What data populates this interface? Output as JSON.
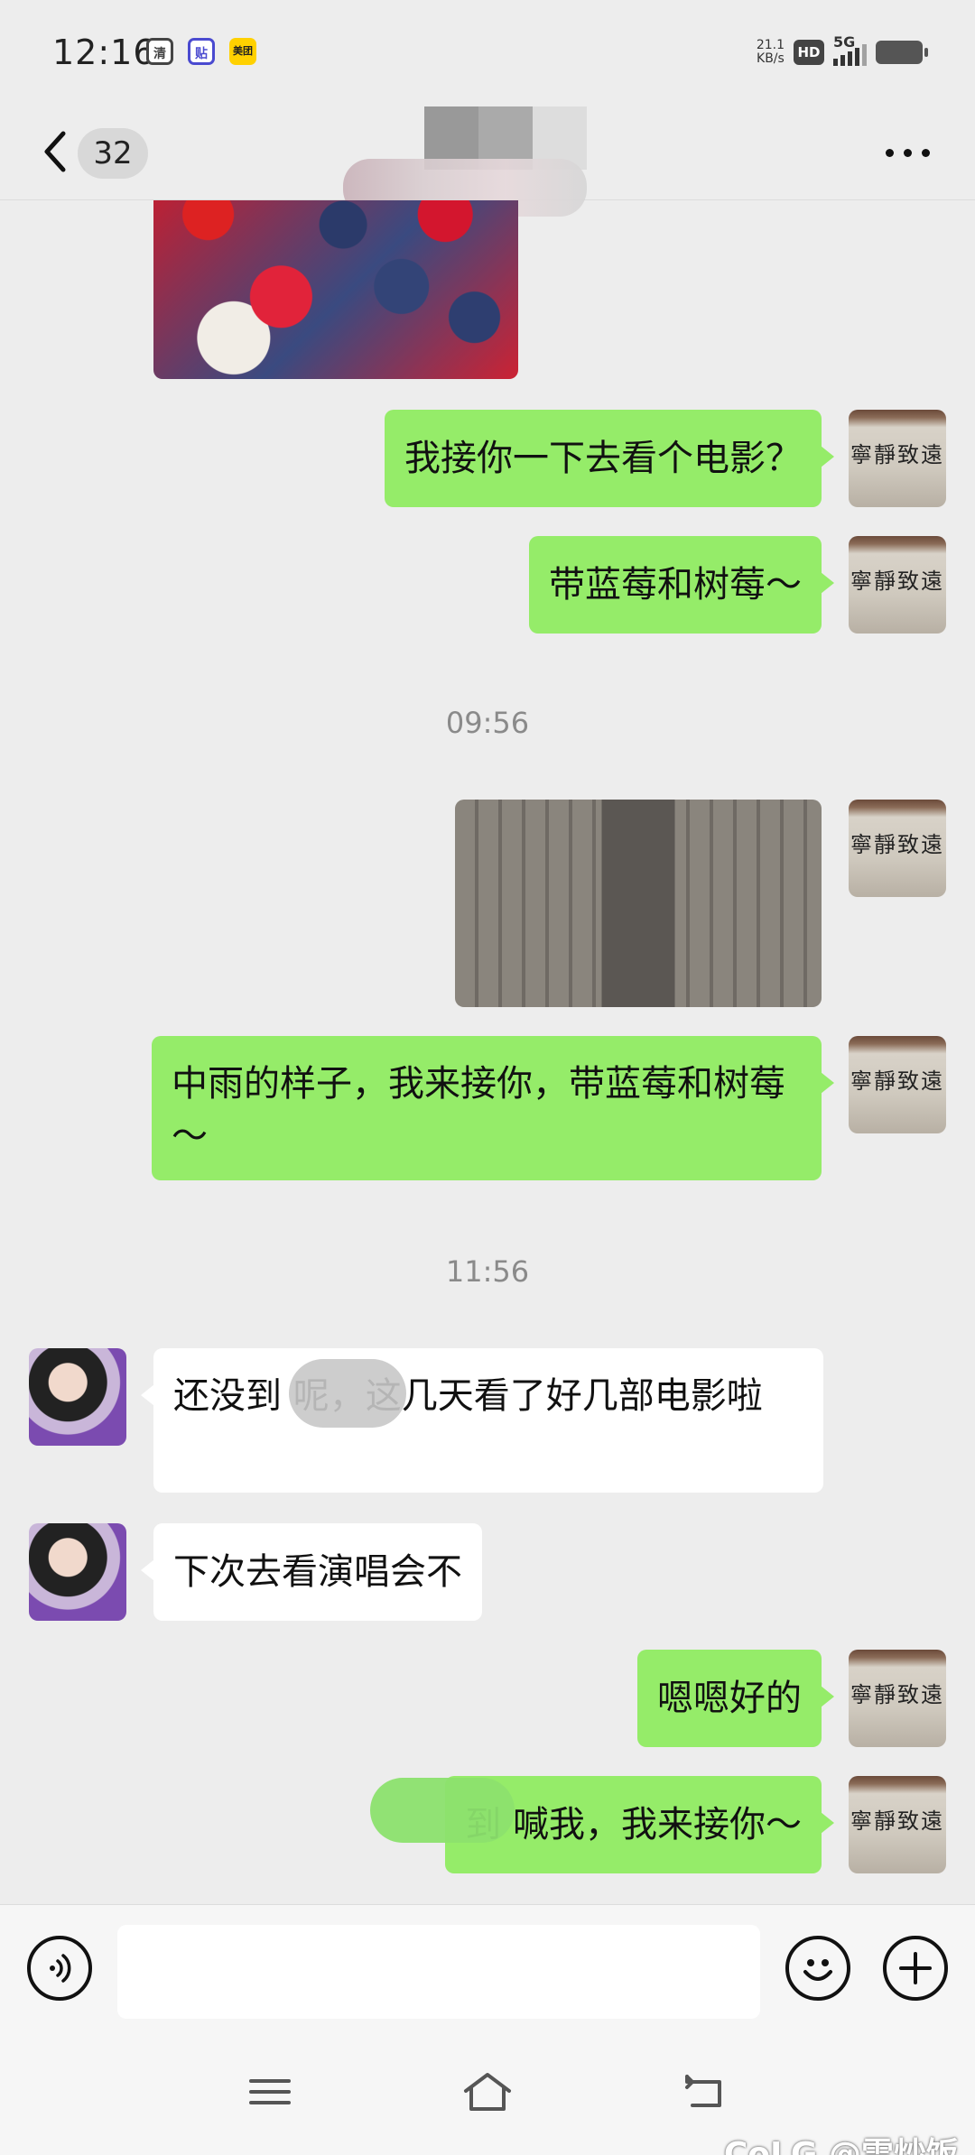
{
  "status_bar": {
    "time": "12:16",
    "app_icons": [
      "清",
      "贴",
      "美团"
    ],
    "net_speed_value": "21.1",
    "net_speed_unit": "KB/s",
    "hd": "HD",
    "network": "5G"
  },
  "header": {
    "unread_count": "32"
  },
  "messages": {
    "m1": "我接你一下去看个电影？",
    "m2": "带蓝莓和树莓～",
    "ts1": "09:56",
    "m3": "中雨的样子，我来接你，带蓝莓和树莓～",
    "ts2": "11:56",
    "m4": "还没到      呢，这几天看了好几部电影啦",
    "m5": "下次去看演唱会不",
    "m6": "嗯嗯好的",
    "m7": "到      喊我，我来接你～"
  },
  "avatar_text": "寧靜致遠",
  "input": {
    "placeholder": ""
  },
  "watermark": "CoLG @雪炒饭",
  "colors": {
    "my_bubble": "#95ec69",
    "her_bubble": "#ffffff",
    "background": "#ededed"
  }
}
